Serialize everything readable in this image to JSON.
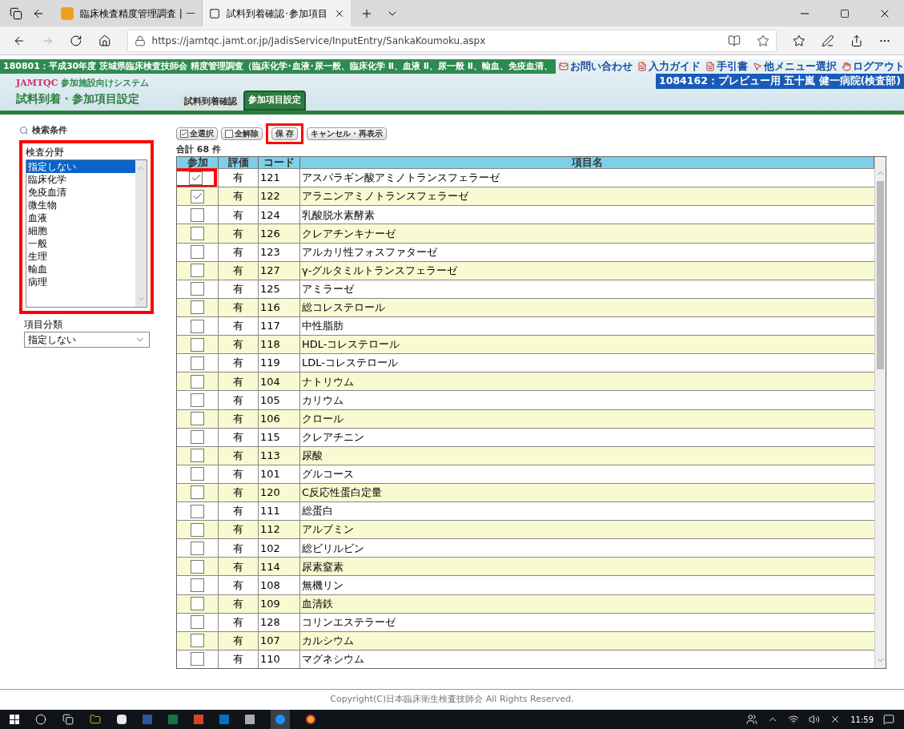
{
  "browser": {
    "tabs": [
      {
        "title": "臨床検査精度管理調査 | 一",
        "selected": false
      },
      {
        "title": "試料到着確認･参加項目",
        "selected": true
      }
    ],
    "url": "https://jamtqc.jamt.or.jp/JadisService/InputEntry/SankaKoumoku.aspx"
  },
  "header": {
    "survey": "180801：平成30年度 茨城県臨床検査技師会 精度管理調査（臨床化学･血液･尿一般、臨床化学 Ⅱ、血液 Ⅱ、尿一般 Ⅱ、輸血、免疫血清、",
    "links": [
      "お問い合わせ",
      "入力ガイド",
      "手引書",
      "他メニュー選択",
      "ログアウト"
    ],
    "brand": "JAMTQC",
    "system": "参加施設向けシステム",
    "page_title": "試料到着・参加項目設定",
    "user": "1084162：プレビュー用 五十嵐 健一病院(検査部)",
    "tabs": [
      {
        "label": "試料到着確認",
        "selected": false
      },
      {
        "label": "参加項目設定",
        "selected": true
      }
    ]
  },
  "search": {
    "title": "検索条件",
    "field_label": "検査分野",
    "highlighted": true,
    "fields": [
      {
        "label": "指定しない",
        "selected": true
      },
      {
        "label": "臨床化学",
        "selected": false
      },
      {
        "label": "免疫血清",
        "selected": false
      },
      {
        "label": "微生物",
        "selected": false
      },
      {
        "label": "血液",
        "selected": false
      },
      {
        "label": "細胞",
        "selected": false
      },
      {
        "label": "一般",
        "selected": false
      },
      {
        "label": "生理",
        "selected": false
      },
      {
        "label": "輸血",
        "selected": false
      },
      {
        "label": "病理",
        "selected": false
      }
    ],
    "category_label": "項目分類",
    "category_value": "指定しない"
  },
  "toolbar": [
    {
      "label": "全選択",
      "kind": "check",
      "highlighted": false
    },
    {
      "label": "全解除",
      "kind": "uncheck",
      "highlighted": false
    },
    {
      "label": "保 存",
      "kind": "plain",
      "highlighted": true
    },
    {
      "label": "キャンセル・再表示",
      "kind": "plain",
      "highlighted": false
    }
  ],
  "total": "合計 68 件",
  "table": {
    "columns": [
      "参加",
      "評価",
      "コード",
      "項目名"
    ],
    "rows": [
      {
        "checked": true,
        "highlighted": true,
        "rating": "有",
        "code": "121",
        "name": "アスパラギン酸アミノトランスフェラーゼ"
      },
      {
        "checked": true,
        "highlighted": false,
        "rating": "有",
        "code": "122",
        "name": "アラニンアミノトランスフェラーゼ"
      },
      {
        "checked": false,
        "highlighted": false,
        "rating": "有",
        "code": "124",
        "name": "乳酸脱水素酵素"
      },
      {
        "checked": false,
        "highlighted": false,
        "rating": "有",
        "code": "126",
        "name": "クレアチンキナーゼ"
      },
      {
        "checked": false,
        "highlighted": false,
        "rating": "有",
        "code": "123",
        "name": "アルカリ性フォスファターゼ"
      },
      {
        "checked": false,
        "highlighted": false,
        "rating": "有",
        "code": "127",
        "name": "γ-グルタミルトランスフェラーゼ"
      },
      {
        "checked": false,
        "highlighted": false,
        "rating": "有",
        "code": "125",
        "name": "アミラーゼ"
      },
      {
        "checked": false,
        "highlighted": false,
        "rating": "有",
        "code": "116",
        "name": "総コレステロール"
      },
      {
        "checked": false,
        "highlighted": false,
        "rating": "有",
        "code": "117",
        "name": "中性脂肪"
      },
      {
        "checked": false,
        "highlighted": false,
        "rating": "有",
        "code": "118",
        "name": "HDL-コレステロール"
      },
      {
        "checked": false,
        "highlighted": false,
        "rating": "有",
        "code": "119",
        "name": "LDL-コレステロール"
      },
      {
        "checked": false,
        "highlighted": false,
        "rating": "有",
        "code": "104",
        "name": "ナトリウム"
      },
      {
        "checked": false,
        "highlighted": false,
        "rating": "有",
        "code": "105",
        "name": "カリウム"
      },
      {
        "checked": false,
        "highlighted": false,
        "rating": "有",
        "code": "106",
        "name": "クロール"
      },
      {
        "checked": false,
        "highlighted": false,
        "rating": "有",
        "code": "115",
        "name": "クレアチニン"
      },
      {
        "checked": false,
        "highlighted": false,
        "rating": "有",
        "code": "113",
        "name": "尿酸"
      },
      {
        "checked": false,
        "highlighted": false,
        "rating": "有",
        "code": "101",
        "name": "グルコース"
      },
      {
        "checked": false,
        "highlighted": false,
        "rating": "有",
        "code": "120",
        "name": "C反応性蛋白定量"
      },
      {
        "checked": false,
        "highlighted": false,
        "rating": "有",
        "code": "111",
        "name": "総蛋白"
      },
      {
        "checked": false,
        "highlighted": false,
        "rating": "有",
        "code": "112",
        "name": "アルブミン"
      },
      {
        "checked": false,
        "highlighted": false,
        "rating": "有",
        "code": "102",
        "name": "総ビリルビン"
      },
      {
        "checked": false,
        "highlighted": false,
        "rating": "有",
        "code": "114",
        "name": "尿素窒素"
      },
      {
        "checked": false,
        "highlighted": false,
        "rating": "有",
        "code": "108",
        "name": "無機リン"
      },
      {
        "checked": false,
        "highlighted": false,
        "rating": "有",
        "code": "109",
        "name": "血清鉄"
      },
      {
        "checked": false,
        "highlighted": false,
        "rating": "有",
        "code": "128",
        "name": "コリンエステラーゼ"
      },
      {
        "checked": false,
        "highlighted": false,
        "rating": "有",
        "code": "107",
        "name": "カルシウム"
      },
      {
        "checked": false,
        "highlighted": false,
        "rating": "有",
        "code": "110",
        "name": "マグネシウム"
      }
    ]
  },
  "footer": "Copyright(C)日本臨床衛生検査技師会 All Rights Reserved.",
  "taskbar": {
    "time": "11:59"
  }
}
